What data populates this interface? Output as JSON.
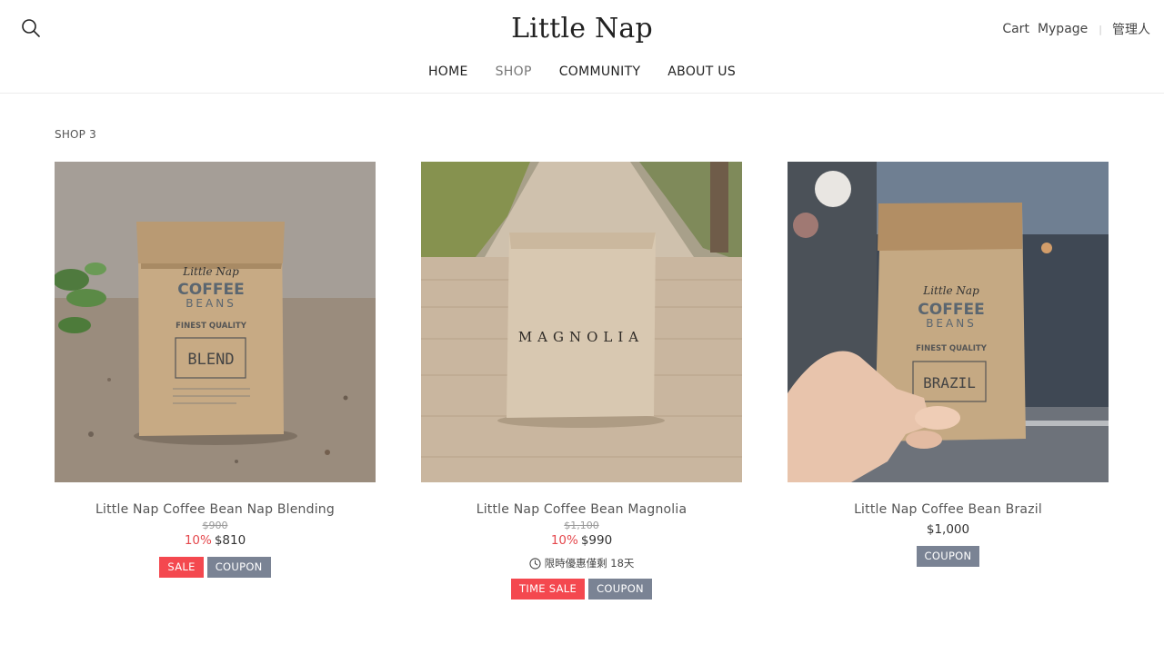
{
  "header": {
    "logo": "Little Nap",
    "util": {
      "cart": "Cart",
      "mypage": "Mypage",
      "separator": "|",
      "admin": "管理人"
    },
    "nav": [
      "HOME",
      "SHOP",
      "COMMUNITY",
      "ABOUT US"
    ],
    "active_nav": "SHOP"
  },
  "breadcrumb": "SHOP 3",
  "colors": {
    "sale": "#f4484f",
    "coupon": "#7a8394",
    "discount_text": "#e5484d"
  },
  "products": [
    {
      "name": "Little Nap Coffee Bean Nap Blending",
      "original_price": "$900",
      "discount": "10%",
      "price": "$810",
      "badges": [
        "SALE",
        "COUPON"
      ],
      "bag_text": {
        "brand": "Little Nap",
        "line1": "COFFEE",
        "line2": "BEANS",
        "quality": "FINEST QUALITY",
        "type": "BLEND"
      }
    },
    {
      "name": "Little Nap Coffee Bean Magnolia",
      "original_price": "$1,100",
      "discount": "10%",
      "price": "$990",
      "countdown": "限時優惠僅剩 18天",
      "badges": [
        "TIME SALE",
        "COUPON"
      ],
      "bag_text": {
        "label": "MAGNOLIA"
      }
    },
    {
      "name": "Little Nap Coffee Bean Brazil",
      "price": "$1,000",
      "badges": [
        "COUPON"
      ],
      "bag_text": {
        "brand": "Little Nap",
        "line1": "COFFEE",
        "line2": "BEANS",
        "quality": "FINEST QUALITY",
        "type": "BRAZIL"
      }
    }
  ]
}
